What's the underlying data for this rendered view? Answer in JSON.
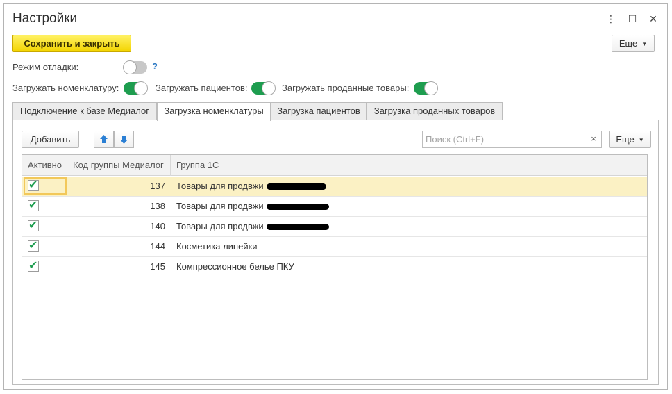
{
  "window": {
    "title": "Настройки",
    "controls": {
      "menu": "⋮",
      "maximize": "☐",
      "close": "✕"
    }
  },
  "toolbar": {
    "save_close_label": "Сохранить и закрыть",
    "more_label": "Еще"
  },
  "settings": {
    "debug_mode": {
      "label": "Режим отладки:",
      "on": false,
      "help": "?"
    },
    "load_nomenclature": {
      "label": "Загружать номенклатуру:",
      "on": true
    },
    "load_patients": {
      "label": "Загружать пациентов:",
      "on": true
    },
    "load_sold_goods": {
      "label": "Загружать проданные товары:",
      "on": true
    }
  },
  "tabs": [
    {
      "label": "Подключение к базе Медиалог",
      "active": false
    },
    {
      "label": "Загрузка номенклатуры",
      "active": true
    },
    {
      "label": "Загрузка пациентов",
      "active": false
    },
    {
      "label": "Загрузка проданных товаров",
      "active": false
    }
  ],
  "panel": {
    "add_label": "Добавить",
    "search_placeholder": "Поиск (Ctrl+F)",
    "search_clear": "×",
    "more_label": "Еще"
  },
  "table": {
    "columns": [
      "Активно",
      "Код группы Медиалог",
      "Группа 1С"
    ],
    "rows": [
      {
        "active": true,
        "code": "137",
        "group": "Товары для продвжи",
        "redacted": true,
        "selected": true
      },
      {
        "active": true,
        "code": "138",
        "group": "Товары для продвжи",
        "redacted": true,
        "selected": false
      },
      {
        "active": true,
        "code": "140",
        "group": "Товары для продвжи",
        "redacted": true,
        "selected": false
      },
      {
        "active": true,
        "code": "144",
        "group": "Косметика линейки",
        "redacted": false,
        "selected": false
      },
      {
        "active": true,
        "code": "145",
        "group": "Компрессионное белье ПКУ",
        "redacted": false,
        "selected": false
      }
    ]
  },
  "colors": {
    "toggle_on": "#1e9d4f",
    "toggle_off": "#c8c8c8",
    "primary_button": "#f3d400",
    "selected_row": "#fbf1c4",
    "arrow_icon": "#2a7fd4"
  },
  "icons": {
    "move_up": "arrow-up-icon",
    "move_down": "arrow-down-icon",
    "dropdown": "chevron-down-icon",
    "checkbox": "checkmark-icon"
  }
}
